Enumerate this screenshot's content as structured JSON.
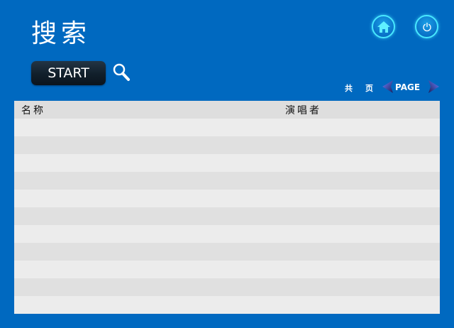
{
  "header": {
    "title": "搜索",
    "home_icon": "home-icon",
    "power_icon": "power-icon"
  },
  "toolbar": {
    "start_label": "START",
    "search_icon": "search-icon"
  },
  "pager": {
    "total_label": "共",
    "unit_label": "页",
    "page_label": "PAGE",
    "prev_icon": "prev-arrow-icon",
    "next_icon": "next-arrow-icon"
  },
  "table": {
    "columns": [
      "名称",
      "演唱者"
    ],
    "rows": [
      [
        "",
        ""
      ],
      [
        "",
        ""
      ],
      [
        "",
        ""
      ],
      [
        "",
        ""
      ],
      [
        "",
        ""
      ],
      [
        "",
        ""
      ],
      [
        "",
        ""
      ],
      [
        "",
        ""
      ],
      [
        "",
        ""
      ],
      [
        "",
        ""
      ],
      [
        "",
        ""
      ]
    ]
  },
  "colors": {
    "background": "#0069c0",
    "accent": "#48e8ff",
    "button_dark": "#111f2b",
    "row_light": "#ececec",
    "row_dark": "#e0e0e0"
  }
}
